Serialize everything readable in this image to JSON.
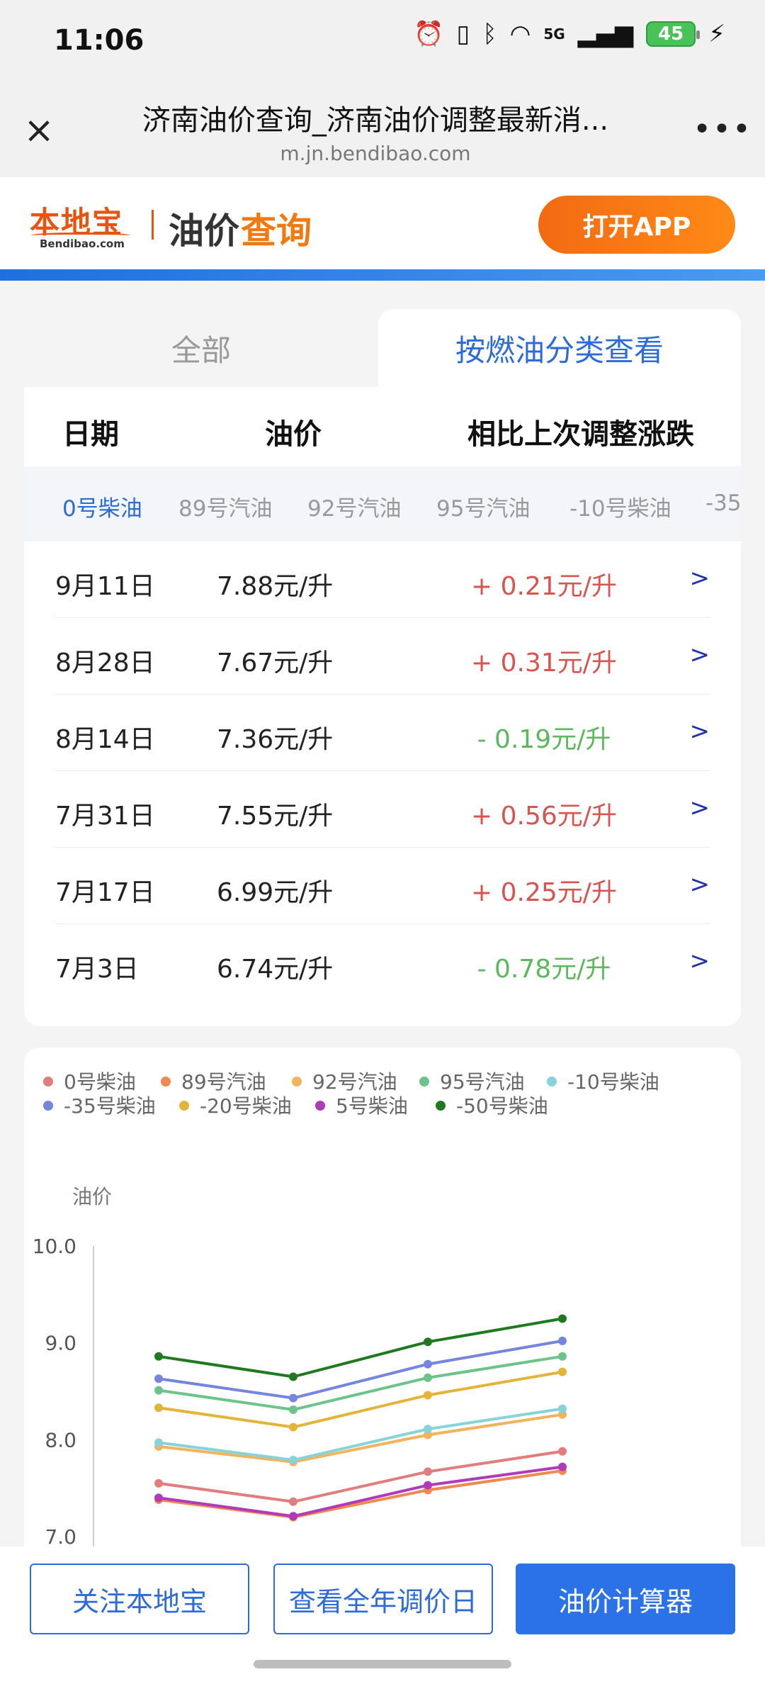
{
  "status_bar": {
    "time": "11:06",
    "network": "5G",
    "battery": "45",
    "icons": [
      "alarm-icon",
      "vibrate-icon",
      "bluetooth-icon",
      "wifi-icon",
      "signal-icon",
      "charging-icon"
    ]
  },
  "browser": {
    "title": "济南油价查询_济南油价调整最新消...",
    "url": "m.jn.bendibao.com",
    "close_icon": "×",
    "more_icon": "•••"
  },
  "header": {
    "logo_text": "本地宝",
    "logo_sub": "Bendibao.com",
    "title_part1": "油价",
    "title_part2": "查询",
    "open_app_label": "打开APP"
  },
  "tabs": {
    "all": "全部",
    "by_fuel": "按燃油分类查看"
  },
  "table": {
    "headers": {
      "date": "日期",
      "price": "油价",
      "change": "相比上次调整涨跌"
    },
    "fuel_tabs": [
      "0号柴油",
      "89号汽油",
      "92号汽油",
      "95号汽油",
      "-10号柴油",
      "-35"
    ],
    "active_fuel": 0,
    "rows": [
      {
        "date": "9月11日",
        "price": "7.88元/升",
        "change": "+ 0.21元/升",
        "direction": "up"
      },
      {
        "date": "8月28日",
        "price": "7.67元/升",
        "change": "+ 0.31元/升",
        "direction": "up"
      },
      {
        "date": "8月14日",
        "price": "7.36元/升",
        "change": "- 0.19元/升",
        "direction": "down"
      },
      {
        "date": "7月31日",
        "price": "7.55元/升",
        "change": "+ 0.56元/升",
        "direction": "up"
      },
      {
        "date": "7月17日",
        "price": "6.99元/升",
        "change": "+ 0.25元/升",
        "direction": "up"
      },
      {
        "date": "7月3日",
        "price": "6.74元/升",
        "change": "- 0.78元/升",
        "direction": "down"
      }
    ],
    "arrow": ">"
  },
  "chart_data": {
    "type": "line",
    "ylabel": "油价",
    "ylim": [
      7.0,
      10.0
    ],
    "yticks": [
      7.0,
      8.0,
      9.0,
      10.0
    ],
    "ytick_labels": [
      "7.0",
      "8.0",
      "9.0",
      "10.0"
    ],
    "x": [
      1,
      2,
      3,
      4
    ],
    "legend_position": "top-left",
    "series": [
      {
        "name": "0号柴油",
        "color": "#e27d7d",
        "values": [
          7.55,
          7.36,
          7.67,
          7.88
        ]
      },
      {
        "name": "89号汽油",
        "color": "#ef8a4e",
        "values": [
          7.38,
          7.2,
          7.48,
          7.68
        ]
      },
      {
        "name": "92号汽油",
        "color": "#f2b35a",
        "values": [
          7.93,
          7.77,
          8.05,
          8.26
        ]
      },
      {
        "name": "95号汽油",
        "color": "#6dc48a",
        "values": [
          8.51,
          8.31,
          8.64,
          8.86
        ]
      },
      {
        "name": "-10号柴油",
        "color": "#86d3d9",
        "values": [
          7.97,
          7.79,
          8.11,
          8.32
        ]
      },
      {
        "name": "-35号柴油",
        "color": "#7485e0",
        "values": [
          8.63,
          8.43,
          8.78,
          9.02
        ]
      },
      {
        "name": "-20号柴油",
        "color": "#e2b53a",
        "values": [
          8.33,
          8.13,
          8.46,
          8.7
        ]
      },
      {
        "name": "5号柴油",
        "color": "#b03aba",
        "values": [
          7.4,
          7.21,
          7.53,
          7.72
        ]
      },
      {
        "name": "-50号柴油",
        "color": "#1f7a1f",
        "values": [
          8.86,
          8.65,
          9.01,
          9.25
        ]
      }
    ]
  },
  "bottom": {
    "follow": "关注本地宝",
    "calendar": "查看全年调价日",
    "calculator": "油价计算器"
  }
}
